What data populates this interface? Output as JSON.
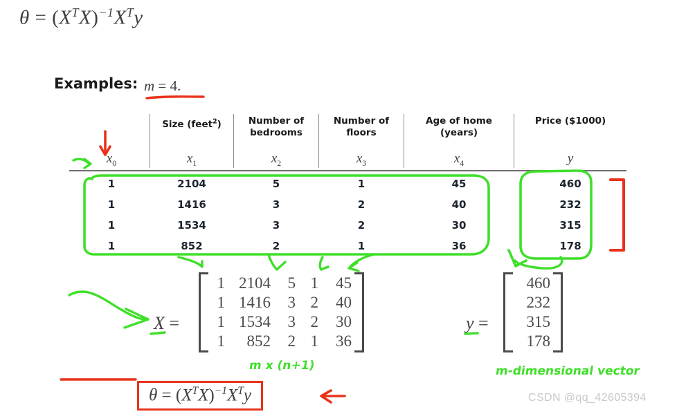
{
  "slide": {
    "top_formula": {
      "theta": "θ",
      "eq": "=",
      "expr": "(X<sup>T</sup>X)<sup>−1</sup>X<sup>T</sup>y",
      "plain": "θ = (X^T X)^-1 X^T y"
    },
    "examples_label": "Examples:",
    "examples_value": "m = 4.",
    "watermark": "CSDN @qq_42605394"
  },
  "table": {
    "headers": [
      "",
      "Size (feet²)",
      "Number of bedrooms",
      "Number of floors",
      "Age of home (years)",
      "Price ($1000)"
    ],
    "subheaders": [
      "x₀",
      "x₁",
      "x₂",
      "x₃",
      "x₄",
      "y"
    ],
    "rows": [
      [
        "1",
        "2104",
        "5",
        "1",
        "45",
        "460"
      ],
      [
        "1",
        "1416",
        "3",
        "2",
        "40",
        "232"
      ],
      [
        "1",
        "1534",
        "3",
        "2",
        "30",
        "315"
      ],
      [
        "1",
        "852",
        "2",
        "1",
        "36",
        "178"
      ]
    ]
  },
  "matrices": {
    "X": {
      "label": "X",
      "equals": "=",
      "rows": [
        [
          "1",
          "2104",
          "5",
          "1",
          "45"
        ],
        [
          "1",
          "1416",
          "3",
          "2",
          "40"
        ],
        [
          "1",
          "1534",
          "3",
          "2",
          "30"
        ],
        [
          "1",
          "852",
          "2",
          "1",
          "36"
        ]
      ]
    },
    "y": {
      "label": "y",
      "equals": "=",
      "rows": [
        [
          "460"
        ],
        [
          "232"
        ],
        [
          "315"
        ],
        [
          "178"
        ]
      ]
    }
  },
  "annotations": {
    "x_dims_note": "m x (n+1)",
    "y_dims_note": "m-dimensional vector",
    "boxed_formula_plain": "θ = (X^T X)^-1 X^T y",
    "colors": {
      "green_ink": "#3fdf2a",
      "red_ink": "#e8331c",
      "rule": "#6f6f6f",
      "math_gray": "#4a4a4a"
    }
  }
}
